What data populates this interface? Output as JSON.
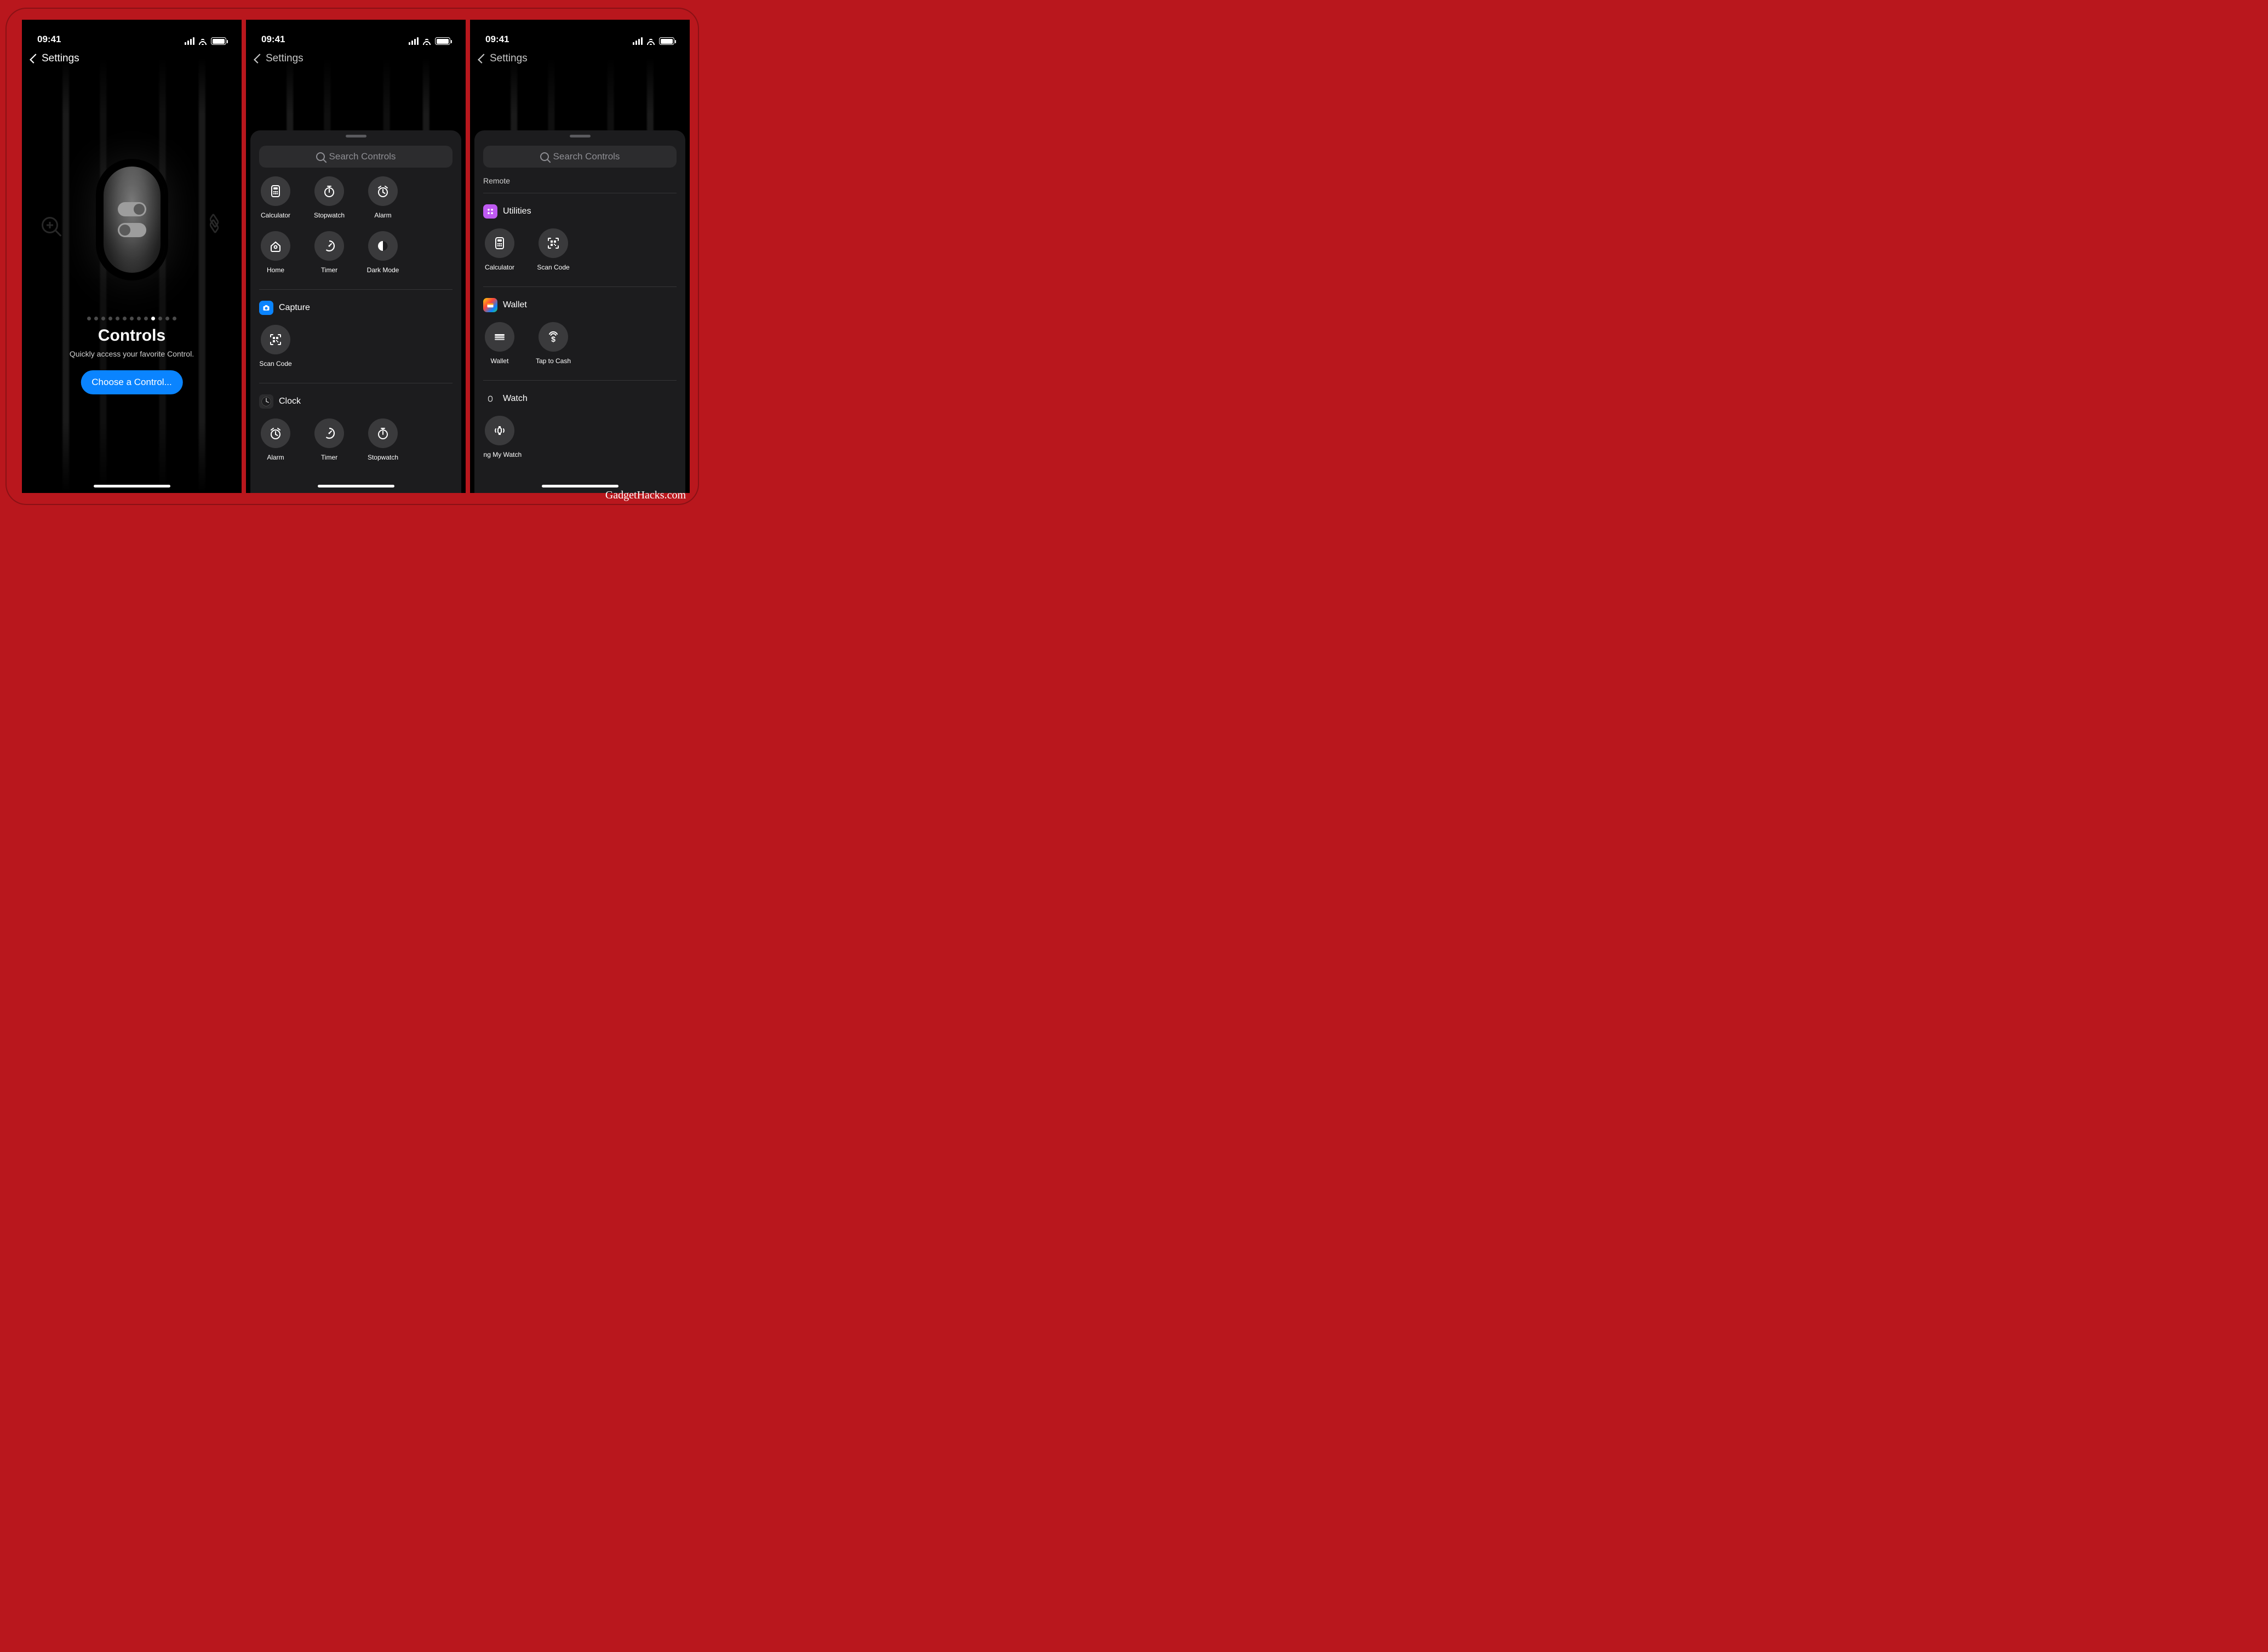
{
  "status_time": "09:41",
  "nav_back": "Settings",
  "panel1": {
    "title": "Controls",
    "subtitle": "Quickly access your favorite Control.",
    "button": "Choose a Control...",
    "dot_count": 13,
    "active_dot": 10
  },
  "sheet": {
    "search_placeholder": "Search Controls"
  },
  "panel2": {
    "top_group": [
      {
        "label": "Calculator",
        "icon": "calculator"
      },
      {
        "label": "Stopwatch",
        "icon": "stopwatch"
      },
      {
        "label": "Alarm",
        "icon": "alarm"
      },
      {
        "label": "Home",
        "icon": "home"
      },
      {
        "label": "Timer",
        "icon": "timer"
      },
      {
        "label": "Dark Mode",
        "icon": "darkmode"
      }
    ],
    "sections": [
      {
        "name": "Capture",
        "icon": "camera",
        "color": "#0a84ff",
        "items": [
          {
            "label": "Scan Code",
            "icon": "qr"
          }
        ]
      },
      {
        "name": "Clock",
        "icon": "clockface",
        "color": "#2c2c2e",
        "items": [
          {
            "label": "Alarm",
            "icon": "alarm"
          },
          {
            "label": "Timer",
            "icon": "timer"
          },
          {
            "label": "Stopwatch",
            "icon": "stopwatch"
          }
        ]
      }
    ]
  },
  "panel3": {
    "top_item": "Remote",
    "sections": [
      {
        "name": "Utilities",
        "icon": "utilities",
        "color": "#bf5af2",
        "items": [
          {
            "label": "Calculator",
            "icon": "calculator"
          },
          {
            "label": "Scan Code",
            "icon": "qr"
          }
        ]
      },
      {
        "name": "Wallet",
        "icon": "wallet-app",
        "color": "linear",
        "items": [
          {
            "label": "Wallet",
            "icon": "wallet"
          },
          {
            "label": "Tap to Cash",
            "icon": "taptocash"
          }
        ]
      },
      {
        "name": "Watch",
        "icon": "watch-app",
        "color": "#000",
        "items": [
          {
            "label": "Ping My Watch",
            "icon": "pingwatch"
          }
        ]
      }
    ]
  },
  "source": "GadgetHacks.com"
}
